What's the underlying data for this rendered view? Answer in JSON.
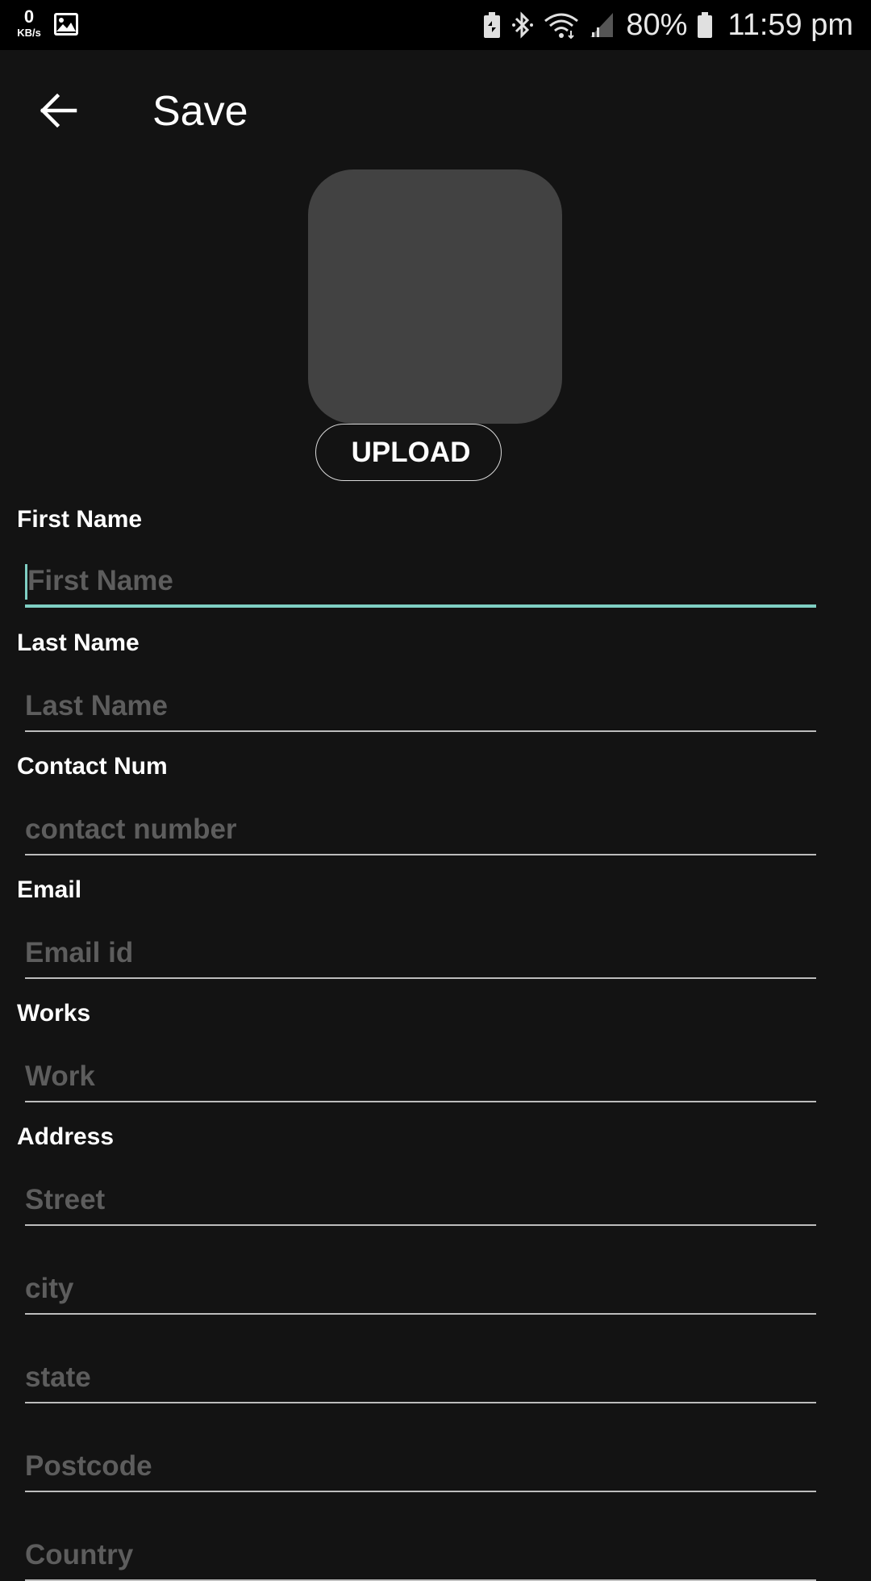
{
  "status_bar": {
    "net_speed_value": "0",
    "net_speed_unit": "KB/s",
    "battery_percent": "80%",
    "time": "11:59 pm",
    "icons": [
      "gallery-icon",
      "battery-saver-icon",
      "bluetooth-icon",
      "wifi-icon",
      "signal-icon",
      "battery-icon"
    ]
  },
  "app_bar": {
    "title": "Save",
    "back_icon": "arrow-back-icon"
  },
  "avatar": {
    "upload_label": "UPLOAD"
  },
  "form": {
    "first_name": {
      "label": "First Name",
      "placeholder": "First Name",
      "value": ""
    },
    "last_name": {
      "label": "Last Name",
      "placeholder": "Last Name",
      "value": ""
    },
    "contact": {
      "label": "Contact Num",
      "placeholder": "contact number",
      "value": ""
    },
    "email": {
      "label": "Email",
      "placeholder": "Email id",
      "value": ""
    },
    "works": {
      "label": "Works",
      "placeholder": "Work",
      "value": ""
    },
    "address": {
      "label": "Address",
      "street_placeholder": "Street",
      "city_placeholder": "city",
      "state_placeholder": "state",
      "postcode_placeholder": "Postcode",
      "country_placeholder": "Country"
    }
  },
  "colors": {
    "background": "#131313",
    "status_bar": "#000000",
    "accent": "#7fcfc3",
    "avatar_placeholder": "#424242",
    "hint_text": "#5d5d5d",
    "underline": "#bdbdbd"
  }
}
